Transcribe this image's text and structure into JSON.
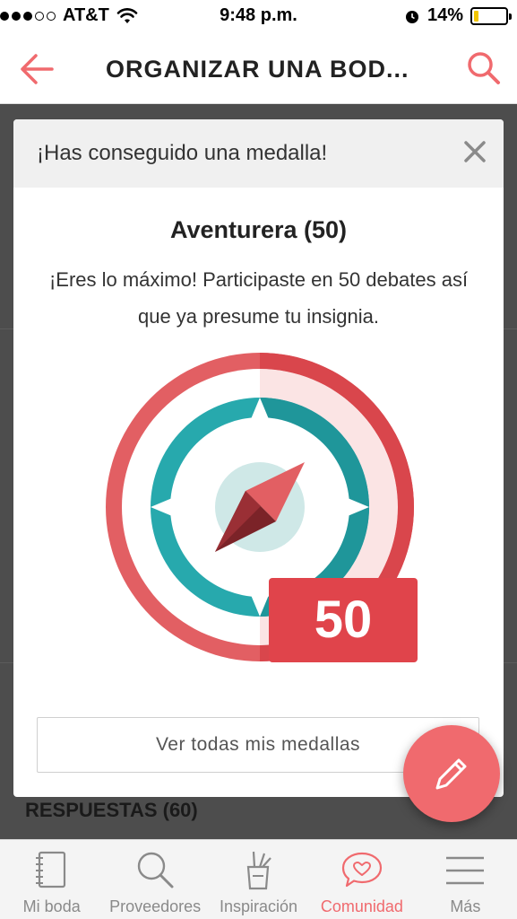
{
  "status_bar": {
    "carrier": "AT&T",
    "time": "9:48 p.m.",
    "battery_percent": "14%",
    "battery_level": 0.14,
    "signal_bars_filled": 3,
    "signal_bars_total": 5
  },
  "nav": {
    "title": "ORGANIZAR UNA BOD...",
    "back_icon": "arrow-left-icon",
    "search_icon": "search-icon",
    "accent_color": "#f06a6e"
  },
  "background": {
    "section_heading": "RESPUESTAS (60)"
  },
  "modal": {
    "header_title": "¡Has conseguido una medalla!",
    "close_icon": "close-icon",
    "medal_name": "Aventurera (50)",
    "description": "¡Eres lo máximo! Participaste en 50 debates así que ya presume tu insignia.",
    "badge_number": "50",
    "badge_icon": "compass-icon",
    "view_all_label": "Ver todas mis medallas"
  },
  "fab": {
    "icon": "pencil-icon"
  },
  "tabs": [
    {
      "label": "Mi boda",
      "icon": "notebook-icon",
      "active": false
    },
    {
      "label": "Proveedores",
      "icon": "search-icon",
      "active": false
    },
    {
      "label": "Inspiración",
      "icon": "pencil-cup-icon",
      "active": false
    },
    {
      "label": "Comunidad",
      "icon": "heart-chat-icon",
      "active": true
    },
    {
      "label": "Más",
      "icon": "menu-icon",
      "active": false
    }
  ]
}
